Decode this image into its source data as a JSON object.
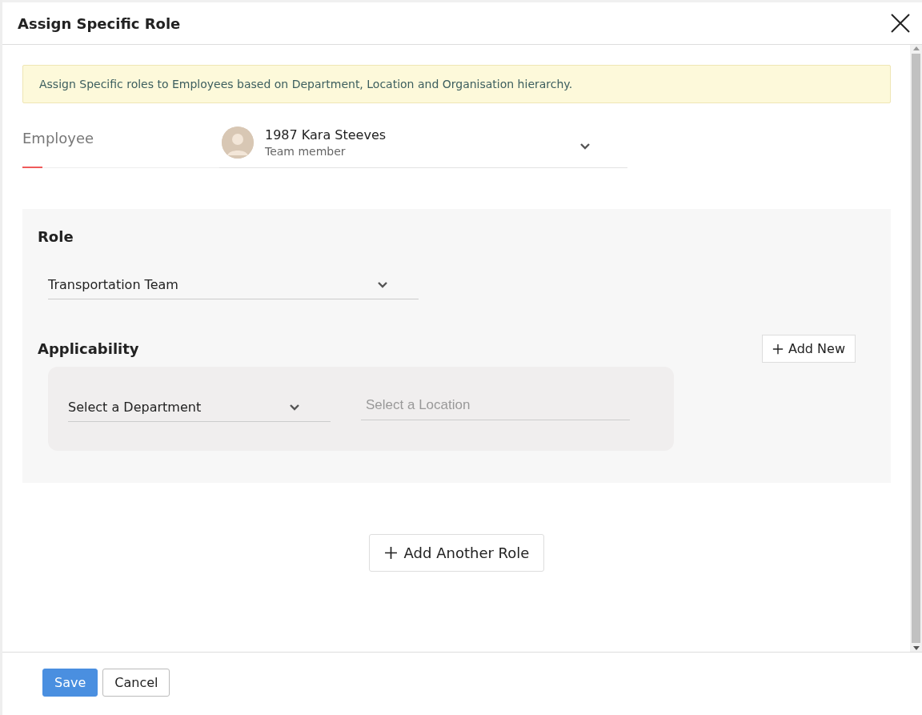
{
  "dialog": {
    "title": "Assign Specific Role"
  },
  "info_banner": "Assign Specific roles to Employees based on Department, Location and Organisation hierarchy.",
  "employee": {
    "label": "Employee",
    "name": "1987 Kara Steeves",
    "subtitle": "Team member"
  },
  "role_section": {
    "heading": "Role",
    "role_value": "Transportation Team",
    "applicability_heading": "Applicability",
    "add_new_button": "Add New",
    "department": {
      "value": "Select a Department"
    },
    "location": {
      "placeholder": "Select a Location"
    }
  },
  "add_another_role_button": "Add Another Role",
  "footer": {
    "buttons": [
      {
        "label": "Save",
        "kind": "primary"
      },
      {
        "label": "Cancel",
        "kind": "secondary"
      }
    ]
  }
}
